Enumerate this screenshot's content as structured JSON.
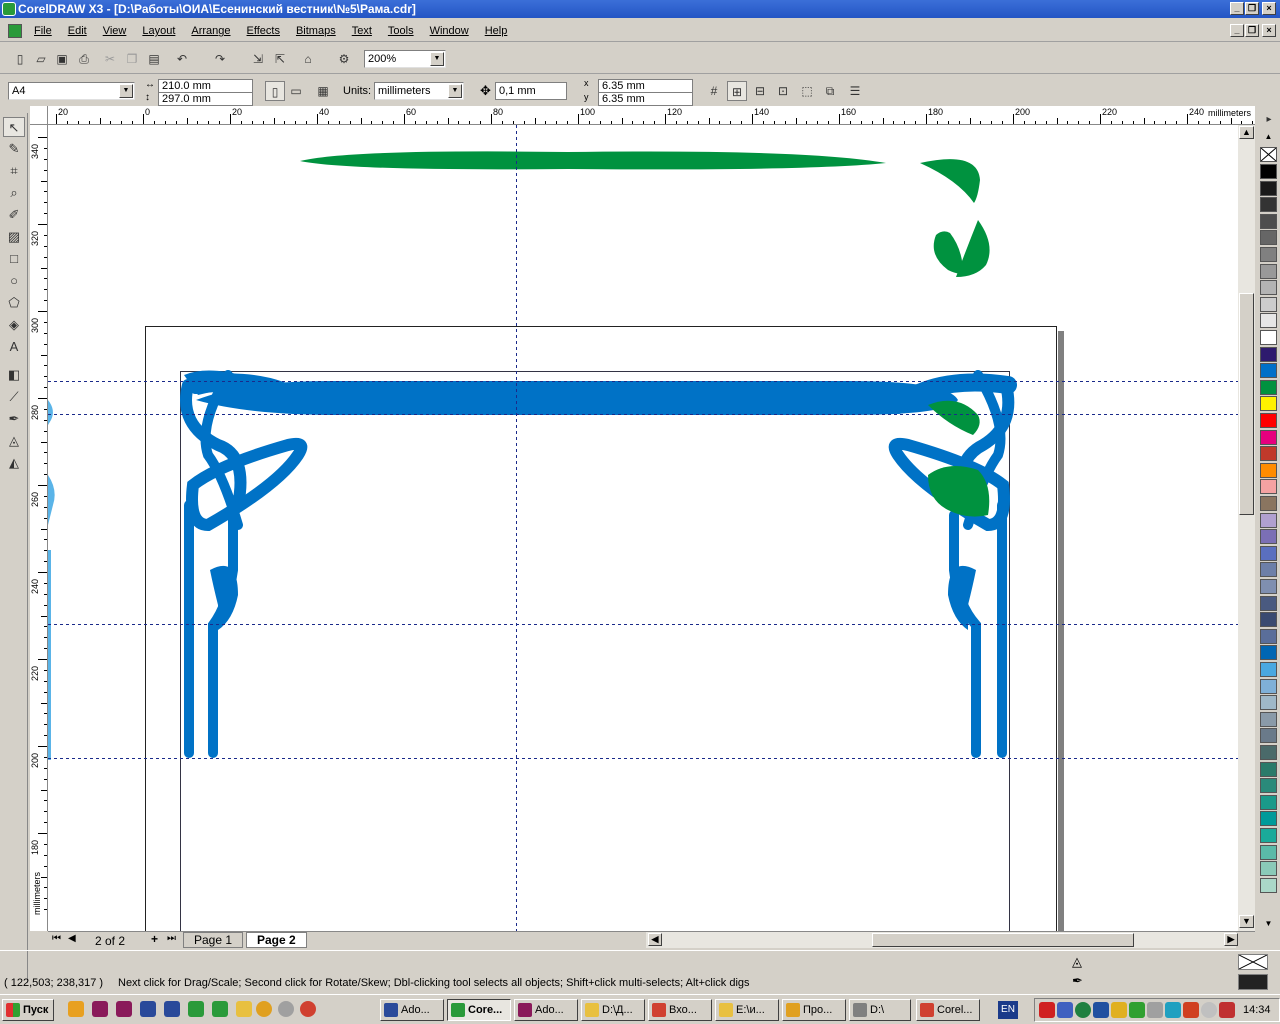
{
  "window": {
    "title": "CorelDRAW X3 - [D:\\Работы\\ОИА\\Есенинский вестник\\№5\\Рама.cdr]"
  },
  "menu": [
    "File",
    "Edit",
    "View",
    "Layout",
    "Arrange",
    "Effects",
    "Bitmaps",
    "Text",
    "Tools",
    "Window",
    "Help"
  ],
  "standard_toolbar": {
    "zoom": "200%"
  },
  "property_bar": {
    "paper": "A4",
    "width": "210.0 mm",
    "height": "297.0 mm",
    "units_label": "Units:",
    "units": "millimeters",
    "nudge": "0,1 mm",
    "dup_x": "6.35 mm",
    "dup_y": "6.35 mm"
  },
  "rulers": {
    "h_ticks": [
      "20",
      "0",
      "20",
      "40",
      "60",
      "80",
      "100",
      "120",
      "140",
      "160",
      "180",
      "200",
      "220",
      "240"
    ],
    "h_unit": "millimeters",
    "v_ticks": [
      "340",
      "320",
      "300",
      "280",
      "260",
      "240",
      "220",
      "200",
      "180"
    ],
    "v_unit": "millimeters"
  },
  "page_nav": {
    "counter": "2 of 2",
    "tabs": [
      "Page 1",
      "Page 2"
    ],
    "active_tab": "Page 2"
  },
  "status": {
    "coords": "( 122,503; 238,317 )",
    "message": "Next click for Drag/Scale; Second click for Rotate/Skew; Dbl-clicking tool selects all objects; Shift+click multi-selects; Alt+click digs"
  },
  "palette": [
    "#000000",
    "#1a1a1a",
    "#333333",
    "#4d4d4d",
    "#666666",
    "#808080",
    "#999999",
    "#b3b3b3",
    "#cccccc",
    "#e6e6e6",
    "#ffffff",
    "#2e1a6e",
    "#0070c8",
    "#00923f",
    "#fff200",
    "#ff0000",
    "#e6007e",
    "#c0392b",
    "#ff8c00",
    "#f4a2a2",
    "#8a7560",
    "#b0a0d0",
    "#7b6fb5",
    "#5a6fbf",
    "#6d7fa8",
    "#7f8fb0",
    "#4a5a80",
    "#3a4a70",
    "#5a6e9a",
    "#0066b3",
    "#4aa8e0",
    "#7fb0d8",
    "#9fb8c8",
    "#8a9aa8",
    "#6a7a8a",
    "#4a6a6a",
    "#2a7a6a",
    "#2a8a7a",
    "#1a9a8a",
    "#009a9a",
    "#1aaa9a",
    "#5abaa8",
    "#8acab8",
    "#aad8c8"
  ],
  "taskbar": {
    "start": "Пуск",
    "tasks": [
      {
        "label": "Ado...",
        "color": "#2a4a9a"
      },
      {
        "label": "Core...",
        "color": "#2a9a3a",
        "active": true
      },
      {
        "label": "Ado...",
        "color": "#8a1a5a"
      },
      {
        "label": "D:\\Д...",
        "color": "#e8c040"
      },
      {
        "label": "Вхо...",
        "color": "#d04030"
      },
      {
        "label": "E:\\и...",
        "color": "#e8c040"
      },
      {
        "label": "Про...",
        "color": "#e0a020"
      },
      {
        "label": "D:\\",
        "color": "#808080"
      },
      {
        "label": "Corel...",
        "color": "#d04030"
      }
    ],
    "lang": "EN",
    "clock": "14:34"
  },
  "icons": {
    "search": "zoom-icon",
    "pointer": "pointer-icon"
  }
}
